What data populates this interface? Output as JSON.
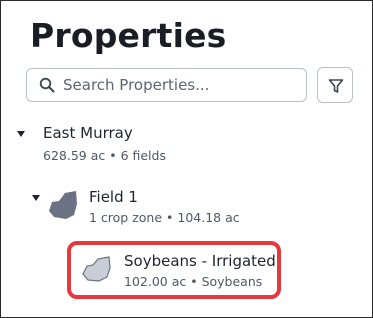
{
  "header": {
    "title": "Properties"
  },
  "search": {
    "placeholder": "Search Properties...",
    "icon": "search-icon"
  },
  "filter": {
    "icon": "filter-icon"
  },
  "tree": {
    "farm": {
      "name": "East Murray",
      "summary": "628.59 ac • 6 fields",
      "expanded": true
    },
    "field": {
      "name": "Field 1",
      "summary": "1 crop zone • 104.18 ac",
      "expanded": true
    },
    "crop_zone": {
      "name": "Soybeans - Irrigated",
      "summary": "102.00 ac • Soybeans",
      "highlighted": true
    }
  },
  "colors": {
    "field_shape": "#6b7283",
    "crop_zone_shape": "#c9cdd6",
    "highlight": "#e5383f"
  }
}
